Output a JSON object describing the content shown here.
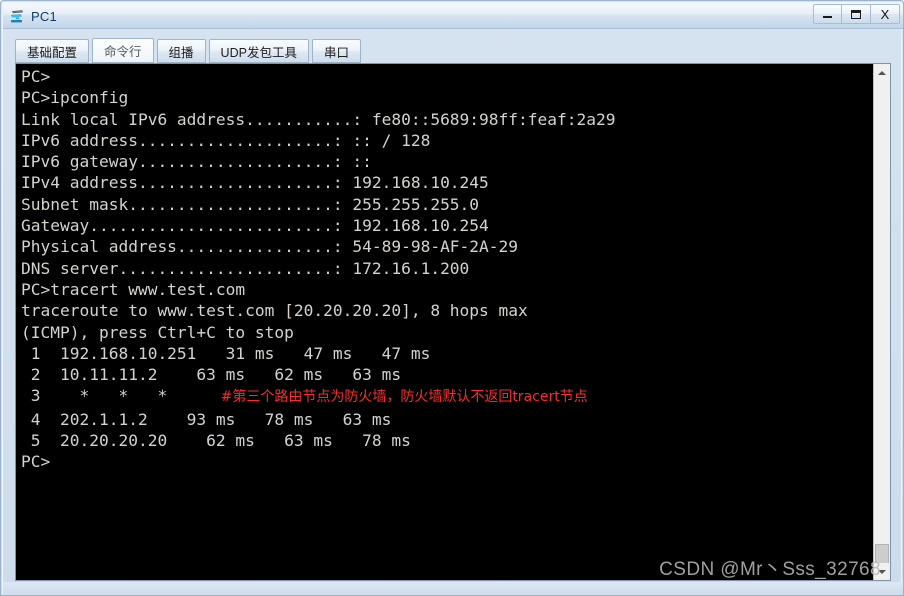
{
  "window": {
    "title": "PC1",
    "icon": "pc-device-icon",
    "buttons": {
      "minimize": "minimize-icon",
      "maximize": "maximize-icon",
      "close": "X"
    }
  },
  "tabs": [
    {
      "label": "基础配置",
      "selected": false
    },
    {
      "label": "命令行",
      "selected": true
    },
    {
      "label": "组播",
      "selected": false
    },
    {
      "label": "UDP发包工具",
      "selected": false
    },
    {
      "label": "串口",
      "selected": false
    }
  ],
  "terminal": {
    "foreground": "#d6d3ce",
    "background": "#000000",
    "annotation_color": "#fb2c2c",
    "lines": [
      "PC>",
      "PC>ipconfig",
      "",
      "Link local IPv6 address...........: fe80::5689:98ff:feaf:2a29",
      "IPv6 address....................: :: / 128",
      "IPv6 gateway....................: ::",
      "IPv4 address....................: 192.168.10.245",
      "Subnet mask.....................: 255.255.255.0",
      "Gateway.........................: 192.168.10.254",
      "Physical address................: 54-89-98-AF-2A-29",
      "DNS server......................: 172.16.1.200",
      "",
      "",
      "PC>tracert www.test.com",
      "",
      "traceroute to www.test.com [20.20.20.20], 8 hops max",
      "(ICMP), press Ctrl+C to stop",
      " 1  192.168.10.251   31 ms   47 ms   47 ms",
      " 2  10.11.11.2    63 ms   62 ms   63 ms",
      " 3    *   *   *",
      " 4  202.1.1.2    93 ms   78 ms   63 ms",
      " 5  20.20.20.20    62 ms   63 ms   78 ms",
      "",
      "PC>"
    ],
    "annotation": {
      "text": "#第三个路由节点为防火墙，防火墙默认不返回tracert节点",
      "line_index": 19
    },
    "ipconfig": {
      "link_local_ipv6_label": "Link local IPv6 address",
      "link_local_ipv6_value": "fe80::5689:98ff:feaf:2a29",
      "ipv6_address_label": "IPv6 address",
      "ipv6_address_value": ":: / 128",
      "ipv6_gateway_label": "IPv6 gateway",
      "ipv6_gateway_value": "::",
      "ipv4_address_label": "IPv4 address",
      "ipv4_address_value": "192.168.10.245",
      "subnet_mask_label": "Subnet mask",
      "subnet_mask_value": "255.255.255.0",
      "gateway_label": "Gateway",
      "gateway_value": "192.168.10.254",
      "physical_address_label": "Physical address",
      "physical_address_value": "54-89-98-AF-2A-29",
      "dns_server_label": "DNS server",
      "dns_server_value": "172.16.1.200"
    },
    "tracert": {
      "command": "tracert www.test.com",
      "header": "traceroute to www.test.com [20.20.20.20], 8 hops max",
      "header2": "(ICMP), press Ctrl+C to stop",
      "target_host": "www.test.com",
      "target_ip": "20.20.20.20",
      "max_hops": "8",
      "hops": [
        {
          "n": "1",
          "host": "192.168.10.251",
          "t1": "31 ms",
          "t2": "47 ms",
          "t3": "47 ms"
        },
        {
          "n": "2",
          "host": "10.11.11.2",
          "t1": "63 ms",
          "t2": "62 ms",
          "t3": "63 ms"
        },
        {
          "n": "3",
          "host": "*  *  *",
          "t1": "",
          "t2": "",
          "t3": ""
        },
        {
          "n": "4",
          "host": "202.1.1.2",
          "t1": "93 ms",
          "t2": "78 ms",
          "t3": "63 ms"
        },
        {
          "n": "5",
          "host": "20.20.20.20",
          "t1": "62 ms",
          "t2": "63 ms",
          "t3": "78 ms"
        }
      ]
    }
  },
  "scrollbar": {
    "up_arrow": "chevron-up-icon",
    "down_arrow": "chevron-down-icon"
  },
  "watermark": "CSDN @Mr丶Sss_32768"
}
